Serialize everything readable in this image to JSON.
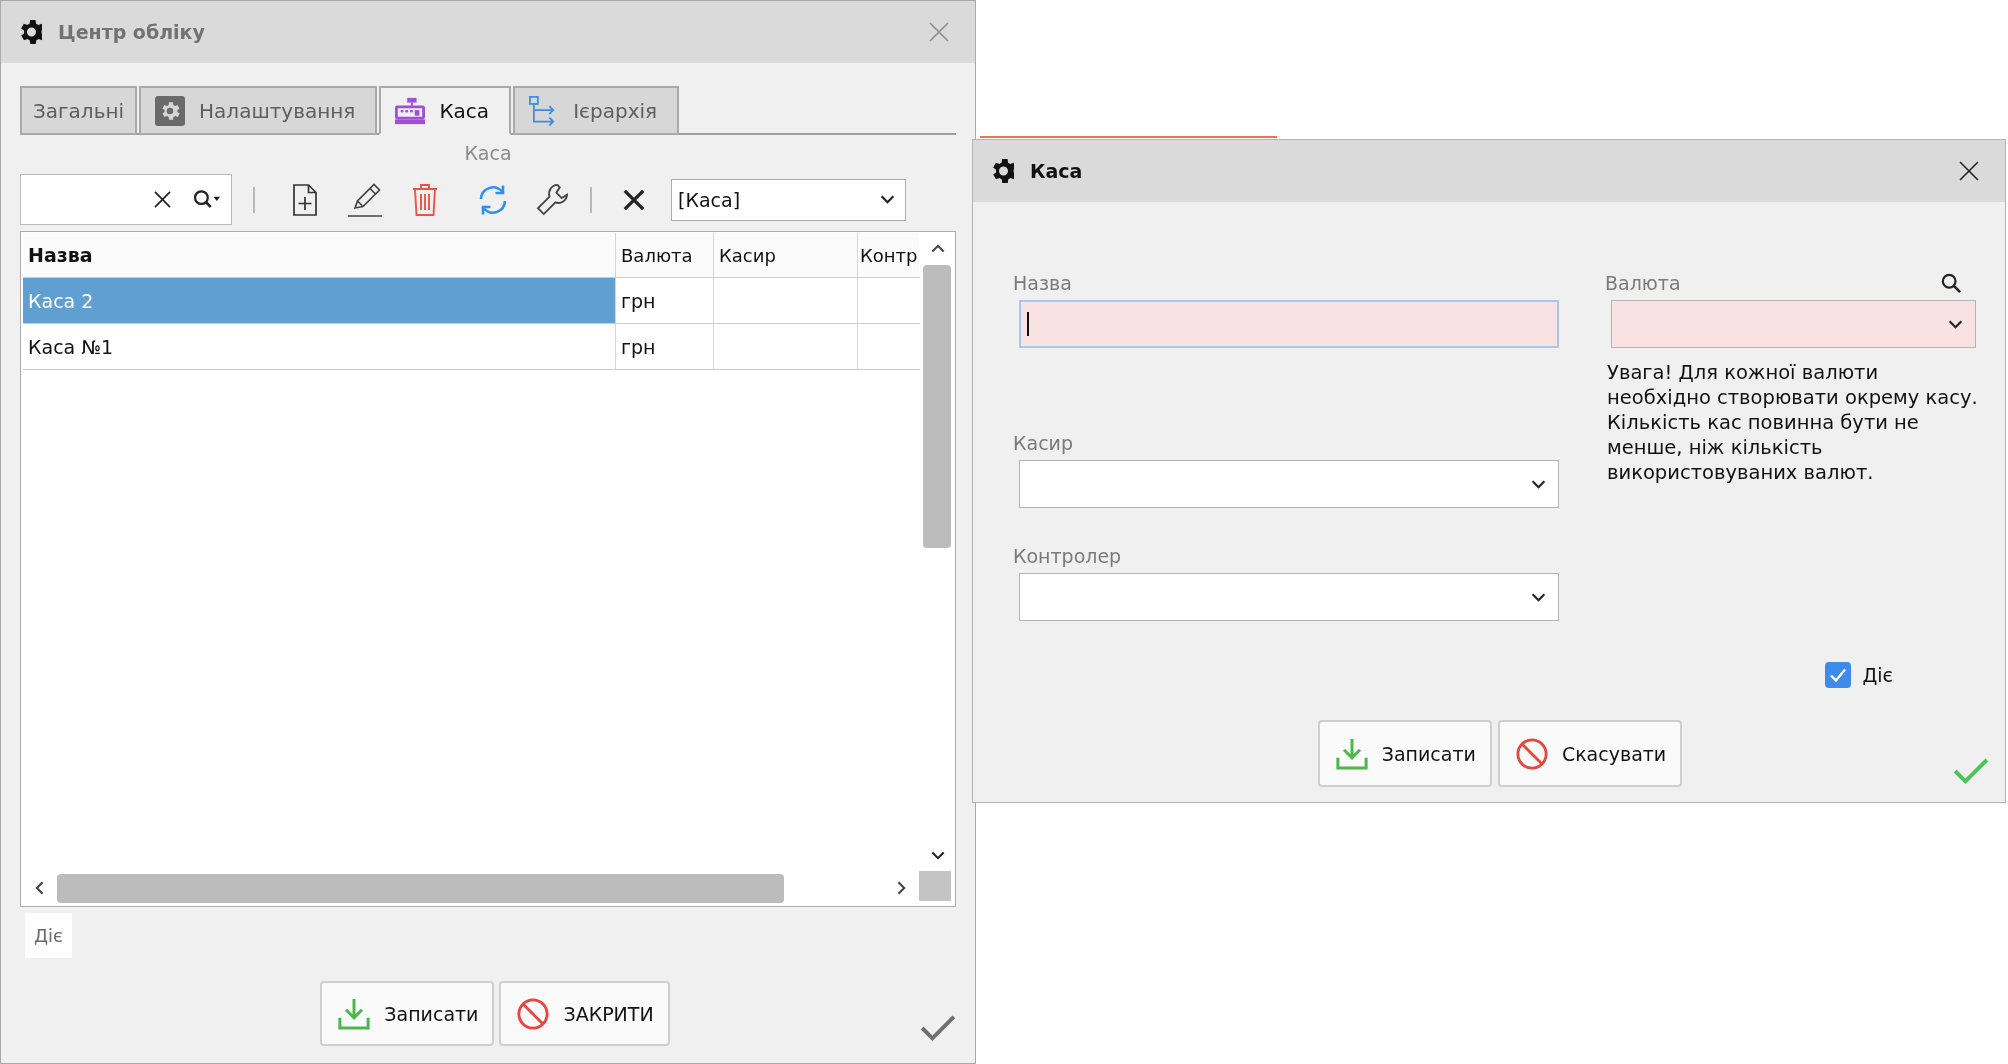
{
  "main_window": {
    "title": "Центр обліку",
    "active": false,
    "tabs": [
      {
        "label": "Загальні",
        "selected": false
      },
      {
        "label": "Налаштування",
        "selected": false
      },
      {
        "label": "Каса",
        "selected": true
      },
      {
        "label": "Ієрархія",
        "selected": false
      }
    ],
    "section_title": "Каса",
    "filter": {
      "value": "[Каса]"
    },
    "table": {
      "columns": [
        "Назва",
        "Валюта",
        "Касир",
        "Контр"
      ],
      "rows": [
        {
          "cells": [
            "Каса 2",
            "грн"
          ],
          "selected": true
        },
        {
          "cells": [
            "Каса №1",
            "грн"
          ],
          "selected": false
        }
      ]
    },
    "legend": "Діє",
    "buttons": [
      {
        "label": "Записати",
        "kind": "save"
      },
      {
        "label": "ЗАКРИТИ",
        "kind": "close"
      }
    ]
  },
  "dialog": {
    "title": "Каса",
    "active": true,
    "fields": [
      {
        "label": "Назва",
        "kind": "text",
        "required": true,
        "focused": true
      },
      {
        "label": "Касир",
        "kind": "select",
        "required": false,
        "focused": false
      },
      {
        "label": "Контролер",
        "kind": "select",
        "required": false,
        "focused": false
      }
    ],
    "currency": {
      "label": "Валюта",
      "required": true,
      "focused": false
    },
    "note": "Увага! Для кожної валюти необхідно створювати окрему касу. Кількість кас повинна бути не менше, ніж кількість використовуваних валют.",
    "active_checkbox": {
      "label": "Діє",
      "checked": true
    },
    "buttons": [
      {
        "label": "Записати",
        "kind": "save"
      },
      {
        "label": "Скасувати",
        "kind": "cancel"
      }
    ]
  }
}
